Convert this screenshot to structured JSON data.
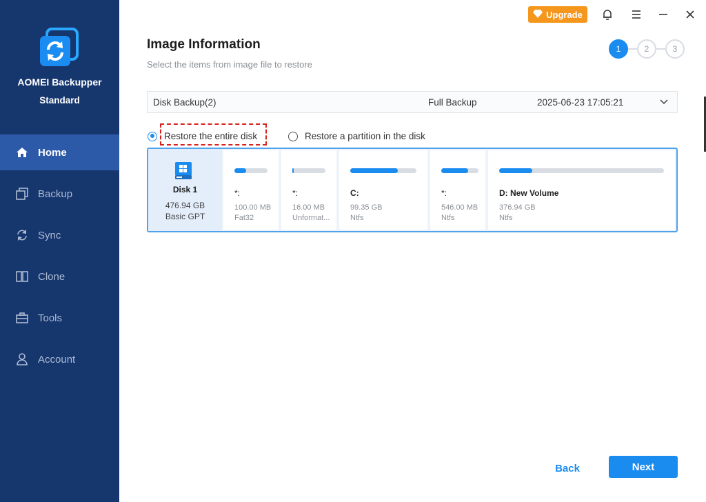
{
  "app": {
    "name_line1": "AOMEI Backupper",
    "name_line2": "Standard"
  },
  "sidebar": {
    "items": [
      {
        "label": "Home",
        "icon": "home-icon",
        "active": true
      },
      {
        "label": "Backup",
        "icon": "backup-icon",
        "active": false
      },
      {
        "label": "Sync",
        "icon": "sync-icon",
        "active": false
      },
      {
        "label": "Clone",
        "icon": "clone-icon",
        "active": false
      },
      {
        "label": "Tools",
        "icon": "tools-icon",
        "active": false
      },
      {
        "label": "Account",
        "icon": "account-icon",
        "active": false
      }
    ]
  },
  "topbar": {
    "upgrade_label": "Upgrade",
    "icons": [
      "bell-icon",
      "menu-icon",
      "minimize-icon",
      "close-icon"
    ]
  },
  "header": {
    "title": "Image Information",
    "subtitle": "Select the items from image file to restore"
  },
  "steps": [
    "1",
    "2",
    "3"
  ],
  "backup": {
    "name": "Disk Backup(2)",
    "type": "Full Backup",
    "date": "2025-06-23 17:05:21"
  },
  "options": {
    "restore_entire": "Restore the entire disk",
    "restore_partition": "Restore a partition in the disk",
    "selected": "restore_entire"
  },
  "disk": {
    "name": "Disk 1",
    "size": "476.94 GB",
    "type": "Basic GPT",
    "partitions": [
      {
        "name": "*:",
        "size": "100.00 MB",
        "fs": "Fat32",
        "used": 0.35
      },
      {
        "name": "*:",
        "size": "16.00 MB",
        "fs": "Unformat...",
        "used": 0.05
      },
      {
        "name": "C:",
        "size": "99.35 GB",
        "fs": "Ntfs",
        "used": 0.72
      },
      {
        "name": "*:",
        "size": "546.00 MB",
        "fs": "Ntfs",
        "used": 0.72
      },
      {
        "name": "D: New Volume",
        "size": "376.94 GB",
        "fs": "Ntfs",
        "used": 0.2
      }
    ]
  },
  "buttons": {
    "back": "Back",
    "next": "Next"
  },
  "colors": {
    "sidebar": "#16366e",
    "sidebar_active": "#2d5aa8",
    "accent": "#1a8cf0",
    "upgrade": "#f5961d",
    "highlight": "#d8201c"
  }
}
